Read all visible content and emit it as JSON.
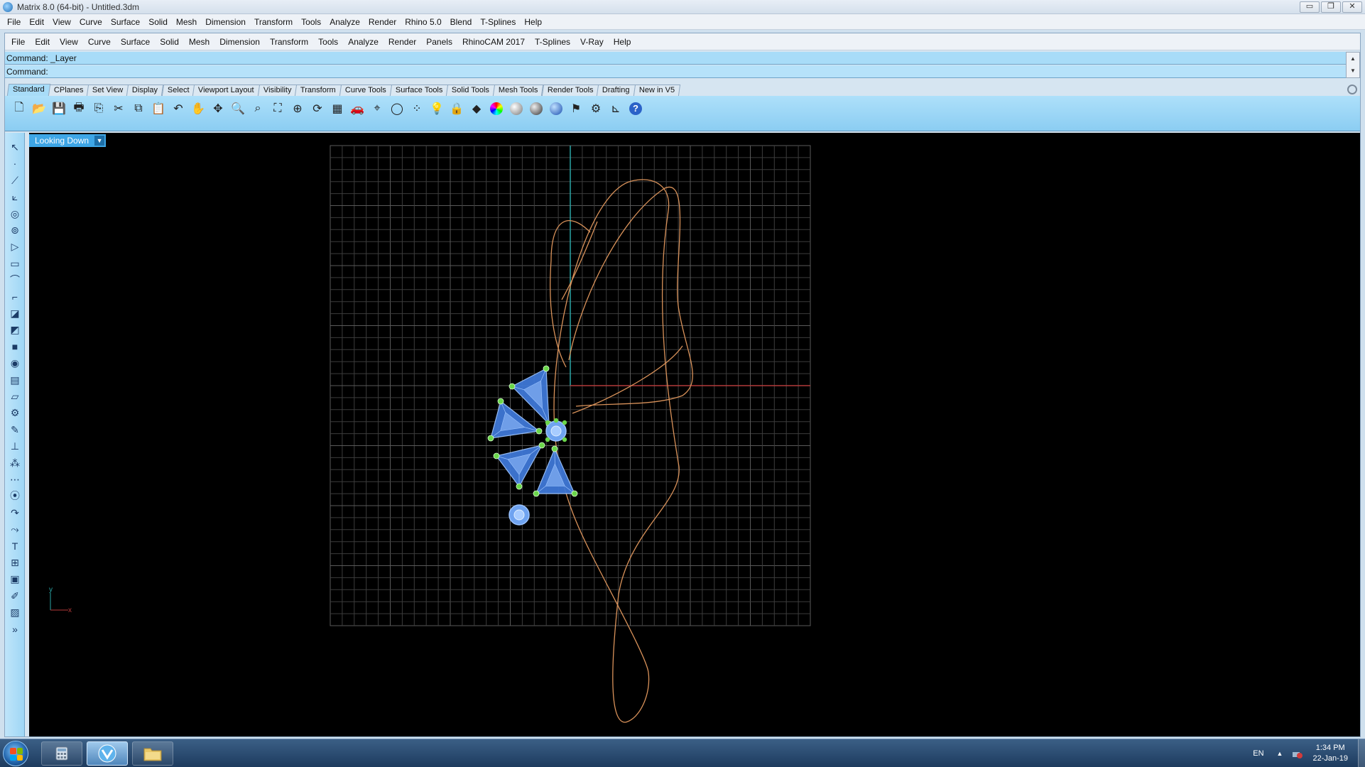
{
  "window": {
    "title": "Matrix 8.0 (64-bit) - Untitled.3dm",
    "min_label": "▭",
    "restore_label": "❐",
    "close_label": "✕"
  },
  "outer_menu": [
    "File",
    "Edit",
    "View",
    "Curve",
    "Surface",
    "Solid",
    "Mesh",
    "Dimension",
    "Transform",
    "Tools",
    "Analyze",
    "Render",
    "Rhino 5.0",
    "Blend",
    "T-Splines",
    "Help"
  ],
  "inner_menu": [
    "File",
    "Edit",
    "View",
    "Curve",
    "Surface",
    "Solid",
    "Mesh",
    "Dimension",
    "Transform",
    "Tools",
    "Analyze",
    "Render",
    "Panels",
    "RhinoCAM 2017",
    "T-Splines",
    "V-Ray",
    "Help"
  ],
  "command": {
    "history": "Command: _Layer",
    "prompt_label": "Command:",
    "prompt_value": ""
  },
  "toolbar_tabs": [
    "Standard",
    "CPlanes",
    "Set View",
    "Display",
    "Select",
    "Viewport Layout",
    "Visibility",
    "Transform",
    "Curve Tools",
    "Surface Tools",
    "Solid Tools",
    "Mesh Tools",
    "Render Tools",
    "Drafting",
    "New in V5"
  ],
  "active_tab": "Standard",
  "toolbar_icons": [
    "new-file-icon",
    "open-folder-icon",
    "save-icon",
    "print-icon",
    "import-icon",
    "cut-icon",
    "copy-icon",
    "paste-icon",
    "undo-icon",
    "pan-hand-icon",
    "move-icon",
    "zoom-icon",
    "zoom-window-icon",
    "zoom-extents-icon",
    "zoom-selected-icon",
    "rotate-view-icon",
    "grid-view-icon",
    "car-icon",
    "cplane-icon",
    "circle-icon",
    "points-icon",
    "light-bulb-icon",
    "lock-icon",
    "material-icon",
    "color-wheel-icon",
    "shaded-sphere-icon",
    "rendered-sphere-icon",
    "blue-sphere-icon",
    "flag-icon",
    "gear-settings-icon",
    "dimension-icon",
    "help-icon"
  ],
  "left_tools": [
    "select-arrow-icon",
    "point-icon",
    "polyline-icon",
    "curve-control-points-icon",
    "circle-icon",
    "ellipse-icon",
    "polygon-icon",
    "rectangle-icon",
    "arc-icon",
    "fillet-icon",
    "surface-corner-icon",
    "surface-freeform-icon",
    "box-solid-icon",
    "boolean-icon",
    "extrude-icon",
    "plane-icon",
    "mesh-gear-icon",
    "transform-drag-icon",
    "dimension-tool-icon",
    "group-icon",
    "array-icon",
    "point-cloud-icon",
    "rotate-icon",
    "offset-icon",
    "text-icon",
    "gumball-icon",
    "block-icon",
    "layer-edit-icon",
    "render-box-icon",
    "expand-more-icon"
  ],
  "viewport": {
    "name": "Looking Down",
    "axis_y_label": "y",
    "axis_x_label": "x"
  },
  "colors": {
    "grid": "#3c3c3c",
    "grid_major": "#5a5a5a",
    "x_axis": "#b33a3a",
    "y_axis": "#2aa6a6",
    "curve": "#d9925a",
    "gem": "#3f78d6",
    "gem_edge": "#9cc4ff",
    "prong": "#6bd64a"
  },
  "taskbar": {
    "items": [
      "start-orb",
      "file-explorer-pinned",
      "matrix-app-active",
      "folder-pinned"
    ],
    "language": "EN",
    "time": "1:34 PM",
    "date": "22-Jan-19"
  }
}
